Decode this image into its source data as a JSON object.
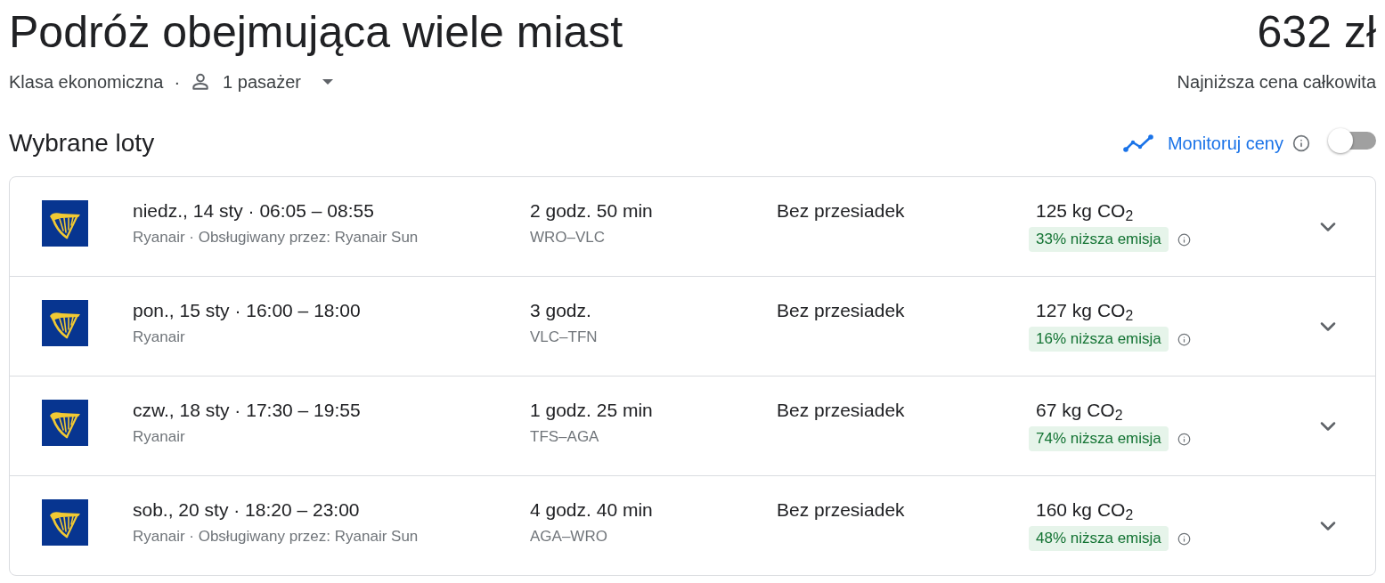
{
  "header": {
    "title": "Podróż obejmująca wiele miast",
    "price": "632 zł",
    "cabin_class": "Klasa ekonomiczna",
    "separator": "·",
    "passengers": "1 pasażer",
    "price_label": "Najniższa cena całkowita"
  },
  "selected_flights": {
    "heading": "Wybrane loty",
    "track_prices": {
      "label": "Monitoruj ceny",
      "on": false
    }
  },
  "flights": [
    {
      "schedule": "niedz., 14 sty · 06:05 – 08:55",
      "carrier": "Ryanair · Obsługiwany przez: Ryanair Sun",
      "duration": "2 godz. 50 min",
      "route": "WRO–VLC",
      "stops": "Bez przesiadek",
      "emissions": "125 kg CO$_{2}$",
      "emissions_badge": "33% niższa emisja",
      "expanded": false
    },
    {
      "schedule": "pon., 15 sty · 16:00 – 18:00",
      "carrier": "Ryanair",
      "duration": "3 godz.",
      "route": "VLC–TFN",
      "stops": "Bez przesiadek",
      "emissions": "127 kg CO$_{2}$",
      "emissions_badge": "16% niższa emisja",
      "expanded": false
    },
    {
      "schedule": "czw., 18 sty · 17:30 – 19:55",
      "carrier": "Ryanair",
      "duration": "1 godz. 25 min",
      "route": "TFS–AGA",
      "stops": "Bez przesiadek",
      "emissions": "67 kg CO$_{2}$",
      "emissions_badge": "74% niższa emisja",
      "expanded": false
    },
    {
      "schedule": "sob., 20 sty · 18:20 – 23:00",
      "carrier": "Ryanair · Obsługiwany przez: Ryanair Sun",
      "duration": "4 godz. 40 min",
      "route": "AGA–WRO",
      "stops": "Bez przesiadek",
      "emissions": "160 kg CO$_{2}$",
      "emissions_badge": "48% niższa emisja",
      "expanded": false
    }
  ]
}
